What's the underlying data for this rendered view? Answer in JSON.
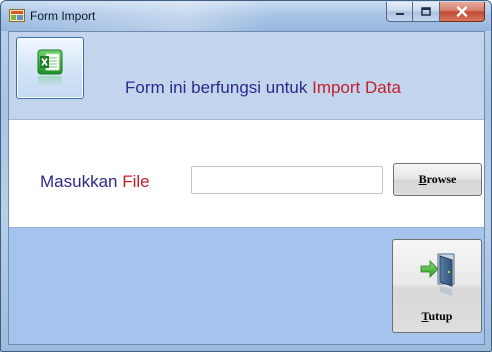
{
  "window": {
    "title": "Form Import"
  },
  "top_panel": {
    "description_part1": "Form ini berfungsi untuk ",
    "description_part2": "Import Data",
    "icon": "excel-icon"
  },
  "form": {
    "file_label_part1": "Masukkan ",
    "file_label_part2": "File",
    "file_value": "",
    "browse_mnemonic": "B",
    "browse_rest": "rowse"
  },
  "footer": {
    "close_mnemonic": "T",
    "close_rest": "utup",
    "close_icon": "exit-door-icon"
  },
  "colors": {
    "label_blue": "#2c2a8c",
    "label_red": "#c0212e",
    "top_panel_bg": "#c3d5ec",
    "bottom_panel_bg": "#a4c4ee"
  }
}
